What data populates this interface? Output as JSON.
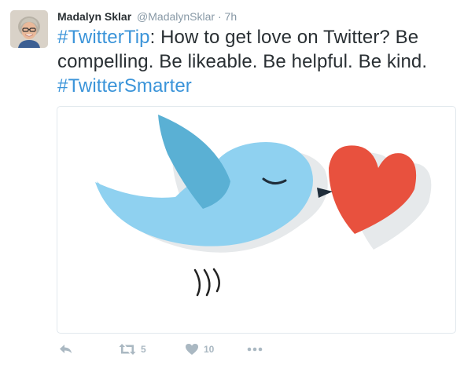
{
  "tweet": {
    "author_name": "Madalyn Sklar",
    "handle": "@MadalynSklar",
    "separator": "·",
    "time": "7h",
    "text_parts": {
      "hashtag1": "#TwitterTip",
      "body": ": How to get love on Twitter? Be compelling. Be likeable. Be helpful. Be kind. ",
      "hashtag2": "#TwitterSmarter"
    }
  },
  "actions": {
    "retweet_count": "5",
    "like_count": "10"
  },
  "colors": {
    "link": "#3b94d9",
    "bird_blue": "#8fd1f0",
    "wing_blue": "#5ab0d4",
    "heart_red": "#e8513e",
    "icon_gray": "#aab8c2"
  },
  "icons": [
    "reply-icon",
    "retweet-icon",
    "heart-icon",
    "more-icon"
  ]
}
